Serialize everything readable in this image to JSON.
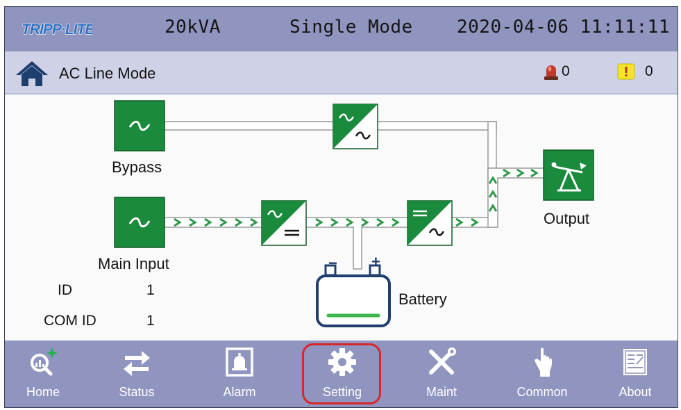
{
  "header": {
    "brand": "TRIPP·LITE",
    "capacity": "20kVA",
    "system_mode": "Single Mode",
    "datetime": "2020-04-06 11:11:11"
  },
  "status": {
    "mode_label": "AC Line Mode",
    "alarm_count": "0",
    "warning_count": "0"
  },
  "diagram": {
    "labels": {
      "bypass": "Bypass",
      "main_input": "Main Input",
      "battery": "Battery",
      "output": "Output"
    },
    "battery_terminals": {
      "negative": "−",
      "positive": "+"
    },
    "info": {
      "id_label": "ID",
      "id_value": "1",
      "com_id_label": "COM ID",
      "com_id_value": "1"
    }
  },
  "nav": {
    "items": [
      {
        "label": "Home",
        "icon": "home-search-icon"
      },
      {
        "label": "Status",
        "icon": "arrows-swap-icon"
      },
      {
        "label": "Alarm",
        "icon": "bell-icon"
      },
      {
        "label": "Setting",
        "icon": "gear-icon"
      },
      {
        "label": "Maint",
        "icon": "tools-icon"
      },
      {
        "label": "Common",
        "icon": "touch-hand-icon"
      },
      {
        "label": "About",
        "icon": "document-icon"
      }
    ],
    "selected": "Setting"
  },
  "colors": {
    "header_bg": "#9095c0",
    "statusbar_bg": "#cfd1e6",
    "module_green": "#1a8a3c",
    "flow_arrow": "#2d9a48",
    "selected_ring": "#d8262b"
  }
}
